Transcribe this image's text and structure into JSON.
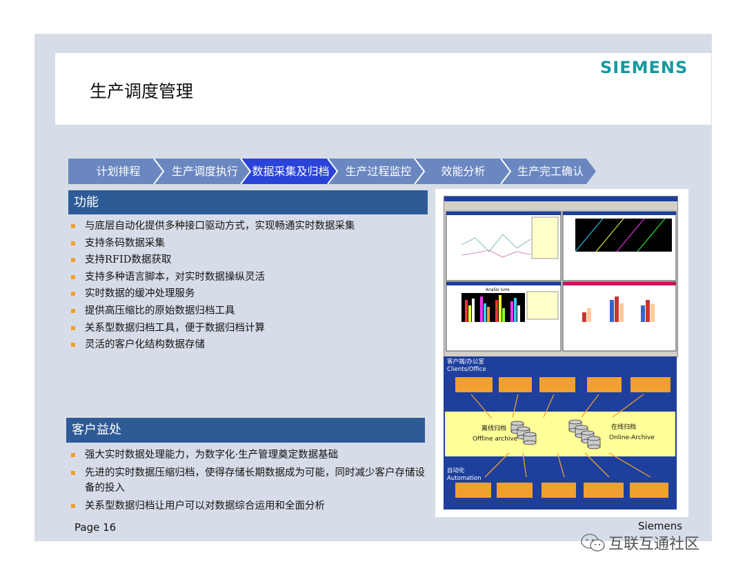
{
  "slide": {
    "title": "生产调度管理",
    "logo": "SIEMENS",
    "page_label": "Page 16",
    "company": "Siemens"
  },
  "pipeline": {
    "steps": [
      "计划排程",
      "生产调度执行",
      "数据采集及归档",
      "生产过程监控",
      "效能分析",
      "生产完工确认"
    ],
    "active_index": 2,
    "colors": {
      "normal": "#6a87c0",
      "active": "#2a44d8"
    }
  },
  "functions": {
    "heading": "功能",
    "items": [
      "与底层自动化提供多种接口驱动方式，实现畅通实时数据采集",
      "支持条码数据采集",
      "支持RFID数据获取",
      "支持多种语言脚本，对实时数据操纵灵活",
      "实时数据的缓冲处理服务",
      "提供高压缩比的原始数据归档工具",
      "关系型数据归档工具，便于数据归档计算",
      "灵活的客户化结构数据存储"
    ]
  },
  "benefits": {
    "heading": "客户益处",
    "items": [
      "强大实时数据处理能力，为数字化·生产管理奠定数据基础",
      "先进的实时数据压缩归档，使得存储长期数据成为可能，同时减少客户存储设备的投入",
      "关系型数据归档让用户可以对数据综合运用和全面分析"
    ]
  },
  "architecture": {
    "clients_label_cn": "客户端/办公室",
    "clients_label_en": "Clients/Office",
    "offline_cn": "离线归档",
    "offline_en": "Offline archive",
    "online_cn": "在线归档",
    "online_en": "Online-Archive",
    "automation_cn": "自动化",
    "automation_en": "Automation",
    "colors": {
      "box": "#f0a030",
      "band": "#1e3f9c",
      "archive": "#ffff99"
    }
  },
  "screenshot": {
    "chart_title": "Analisi Iumi"
  },
  "watermark": {
    "text": "互联互通社区",
    "icon": "wechat-icon"
  }
}
